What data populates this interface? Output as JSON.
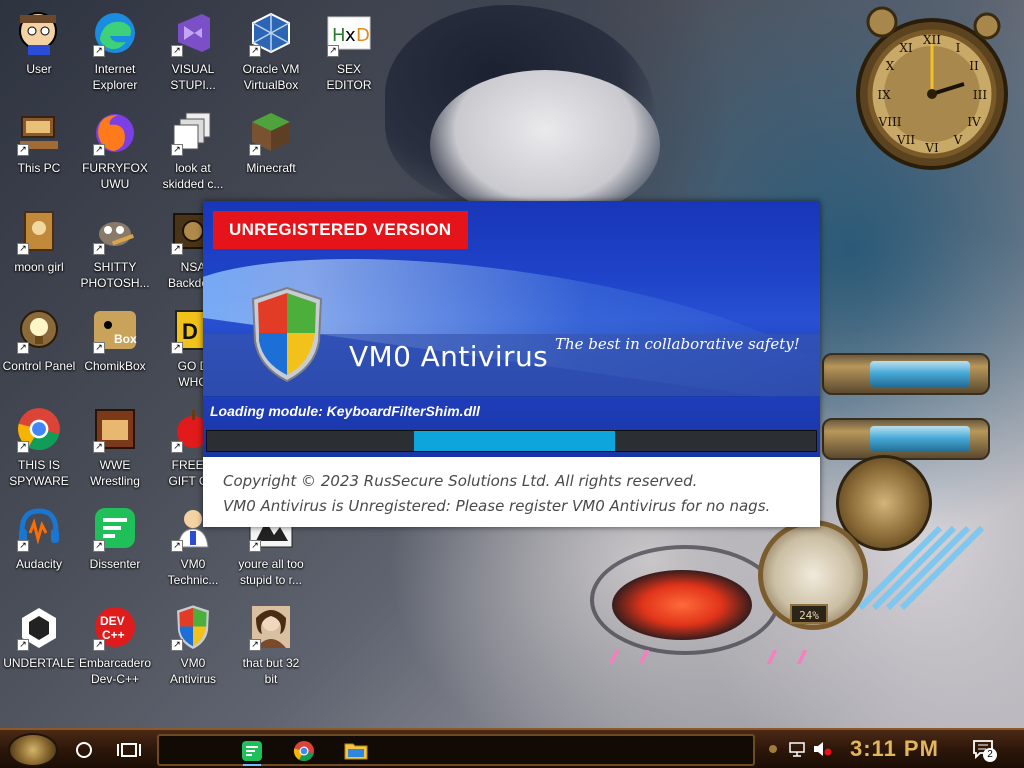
{
  "desktop": {
    "icons": [
      {
        "label": "User",
        "icon": "user-avatar-icon"
      },
      {
        "label": "Internet\nExplorer",
        "icon": "edge-browser-icon"
      },
      {
        "label": "VISUAL\nSTUPI...",
        "icon": "visual-studio-icon"
      },
      {
        "label": "Oracle VM\nVirtualBox",
        "icon": "virtualbox-icon"
      },
      {
        "label": "SEX\nEDITOR",
        "icon": "hex-editor-icon"
      },
      {
        "label": "This PC",
        "icon": "computer-icon"
      },
      {
        "label": "FURRYFOX\nUWU",
        "icon": "firefox-icon"
      },
      {
        "label": "look at\nskidded c...",
        "icon": "copy-files-icon"
      },
      {
        "label": "Minecraft",
        "icon": "minecraft-block-icon"
      },
      {
        "label": "moon girl",
        "icon": "tome-icon"
      },
      {
        "label": "SHITTY\nPHOTOSH...",
        "icon": "gimp-icon"
      },
      {
        "label": "NSA\nBackdo...",
        "icon": "gear-box-icon"
      },
      {
        "label": "Control Panel",
        "icon": "lightbulb-icon"
      },
      {
        "label": "ChomikBox",
        "icon": "chomikbox-icon"
      },
      {
        "label": "GO D\nWHO",
        "icon": "dvd-icon"
      },
      {
        "label": "THIS IS\nSPYWARE",
        "icon": "chrome-icon"
      },
      {
        "label": "WWE\nWrestling",
        "icon": "oven-icon"
      },
      {
        "label": "FREE A\nGIFT C...",
        "icon": "apple-icon"
      },
      {
        "label": "Audacity",
        "icon": "audacity-icon"
      },
      {
        "label": "Dissenter",
        "icon": "dissenter-icon"
      },
      {
        "label": "VM0\nTechnic...",
        "icon": "technician-icon"
      },
      {
        "label": "youre all too\nstupid to r...",
        "icon": "comic-image-icon"
      },
      {
        "label": "UNDERTALE",
        "icon": "unity-icon"
      },
      {
        "label": "Embarcadero\nDev-C++",
        "icon": "devcpp-icon"
      },
      {
        "label": "VM0\nAntivirus",
        "icon": "shield-icon"
      },
      {
        "label": "that but 32\nbit",
        "icon": "portrait-icon"
      }
    ]
  },
  "splash": {
    "badge": "UNREGISTERED VERSION",
    "product_name": "VM0 Antivirus",
    "tagline": "The best in collaborative safety!",
    "loading_text": "Loading module: KeyboardFilterShim.dll",
    "progress": {
      "start": 0.34,
      "end": 0.67
    },
    "copyright": "Copyright © 2023 RusSecure Solutions Ltd. All rights reserved.",
    "nag": "VM0 Antivirus is Unregistered: Please register VM0 Antivirus for no nags.",
    "colors": {
      "badge": "#e5141a",
      "banner": "#1f44c9",
      "progress": "#0ea4dc"
    }
  },
  "widgets": {
    "gauge_percent": "24%"
  },
  "taskbar": {
    "pinned_apps": [
      {
        "name": "Dissenter",
        "icon": "dissenter-icon"
      },
      {
        "name": "Chrome",
        "icon": "chrome-icon"
      },
      {
        "name": "File Explorer",
        "icon": "folder-icon"
      }
    ],
    "clock": "3:11 PM",
    "notification_count": "2",
    "accent": "#e2b65d"
  }
}
